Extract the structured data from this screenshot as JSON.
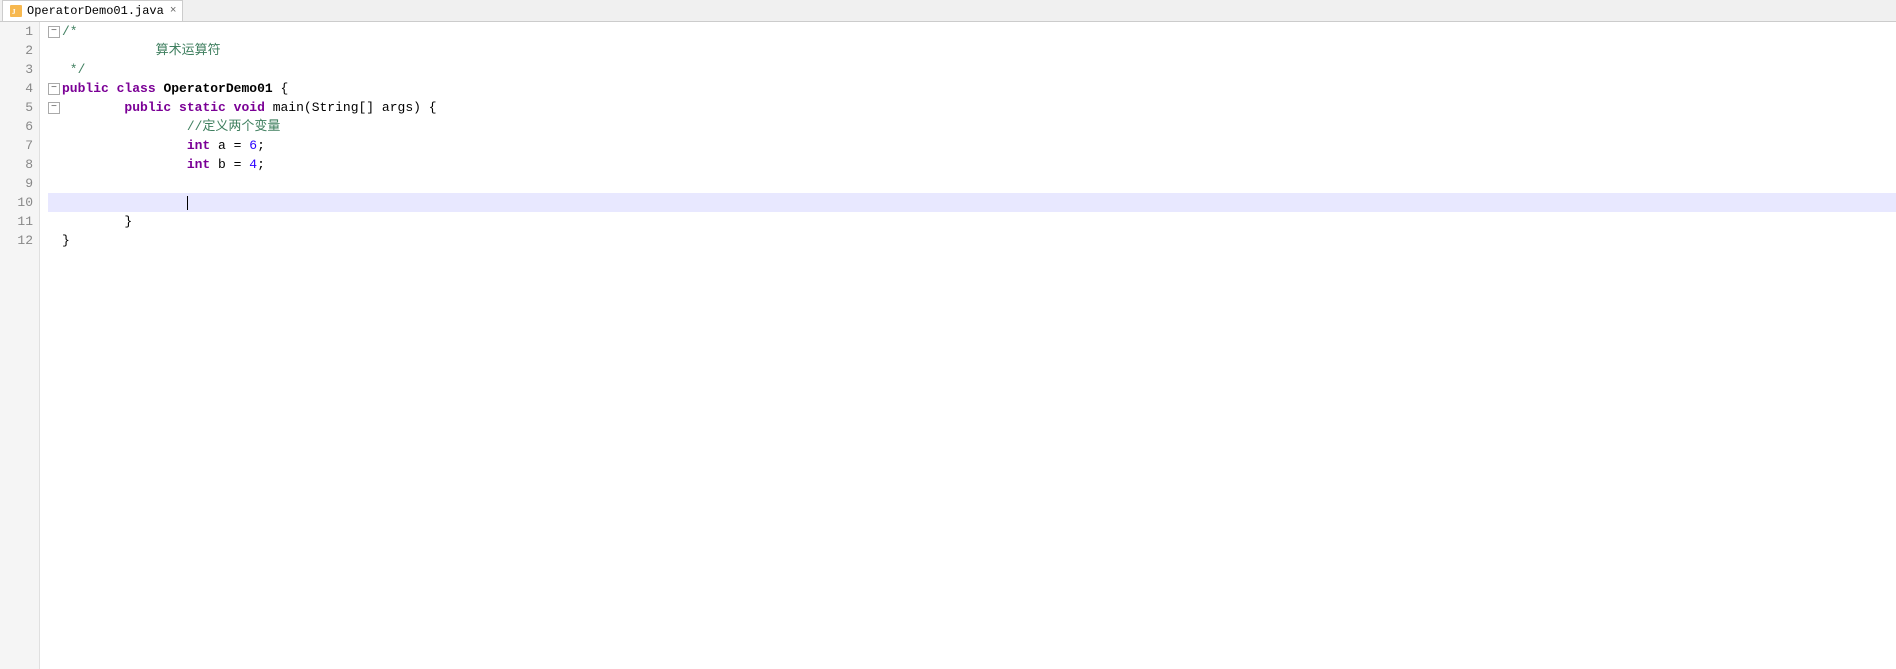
{
  "tab": {
    "label": "OperatorDemo01.java",
    "icon": "java-file-icon",
    "close_label": "×"
  },
  "lines": [
    {
      "num": 1,
      "fold": "minus",
      "content": [
        {
          "type": "comment",
          "text": "/*"
        }
      ]
    },
    {
      "num": 2,
      "fold": null,
      "content": [
        {
          "type": "comment",
          "text": "\t    算术运算符"
        }
      ]
    },
    {
      "num": 3,
      "fold": null,
      "content": [
        {
          "type": "comment",
          "text": " */"
        }
      ]
    },
    {
      "num": 4,
      "fold": "minus",
      "content": [
        {
          "type": "kw",
          "text": "public"
        },
        {
          "type": "plain",
          "text": " "
        },
        {
          "type": "kw",
          "text": "class"
        },
        {
          "type": "plain",
          "text": " "
        },
        {
          "type": "class-name",
          "text": "OperatorDemo01"
        },
        {
          "type": "plain",
          "text": " {"
        }
      ]
    },
    {
      "num": 5,
      "fold": "minus",
      "content": [
        {
          "type": "plain",
          "text": "\t"
        },
        {
          "type": "kw",
          "text": "public"
        },
        {
          "type": "plain",
          "text": " "
        },
        {
          "type": "kw",
          "text": "static"
        },
        {
          "type": "plain",
          "text": " "
        },
        {
          "type": "kw",
          "text": "void"
        },
        {
          "type": "plain",
          "text": " main(String[] args) {"
        }
      ]
    },
    {
      "num": 6,
      "fold": null,
      "content": [
        {
          "type": "plain",
          "text": "\t\t"
        },
        {
          "type": "chinese-comment",
          "text": "//定义两个变量"
        }
      ]
    },
    {
      "num": 7,
      "fold": null,
      "content": [
        {
          "type": "plain",
          "text": "\t\t"
        },
        {
          "type": "kw-type",
          "text": "int"
        },
        {
          "type": "plain",
          "text": " a = "
        },
        {
          "type": "number",
          "text": "6"
        },
        {
          "type": "plain",
          "text": ";"
        }
      ]
    },
    {
      "num": 8,
      "fold": null,
      "content": [
        {
          "type": "plain",
          "text": "\t\t"
        },
        {
          "type": "kw-type",
          "text": "int"
        },
        {
          "type": "plain",
          "text": " b = "
        },
        {
          "type": "number",
          "text": "4"
        },
        {
          "type": "plain",
          "text": ";"
        }
      ]
    },
    {
      "num": 9,
      "fold": null,
      "content": [
        {
          "type": "plain",
          "text": ""
        }
      ]
    },
    {
      "num": 10,
      "fold": null,
      "content": [
        {
          "type": "plain",
          "text": "\t\t"
        }
      ],
      "active": true,
      "cursor": true
    },
    {
      "num": 11,
      "fold": null,
      "content": [
        {
          "type": "plain",
          "text": "\t}"
        }
      ]
    },
    {
      "num": 12,
      "fold": null,
      "content": [
        {
          "type": "plain",
          "text": "}"
        }
      ]
    }
  ]
}
